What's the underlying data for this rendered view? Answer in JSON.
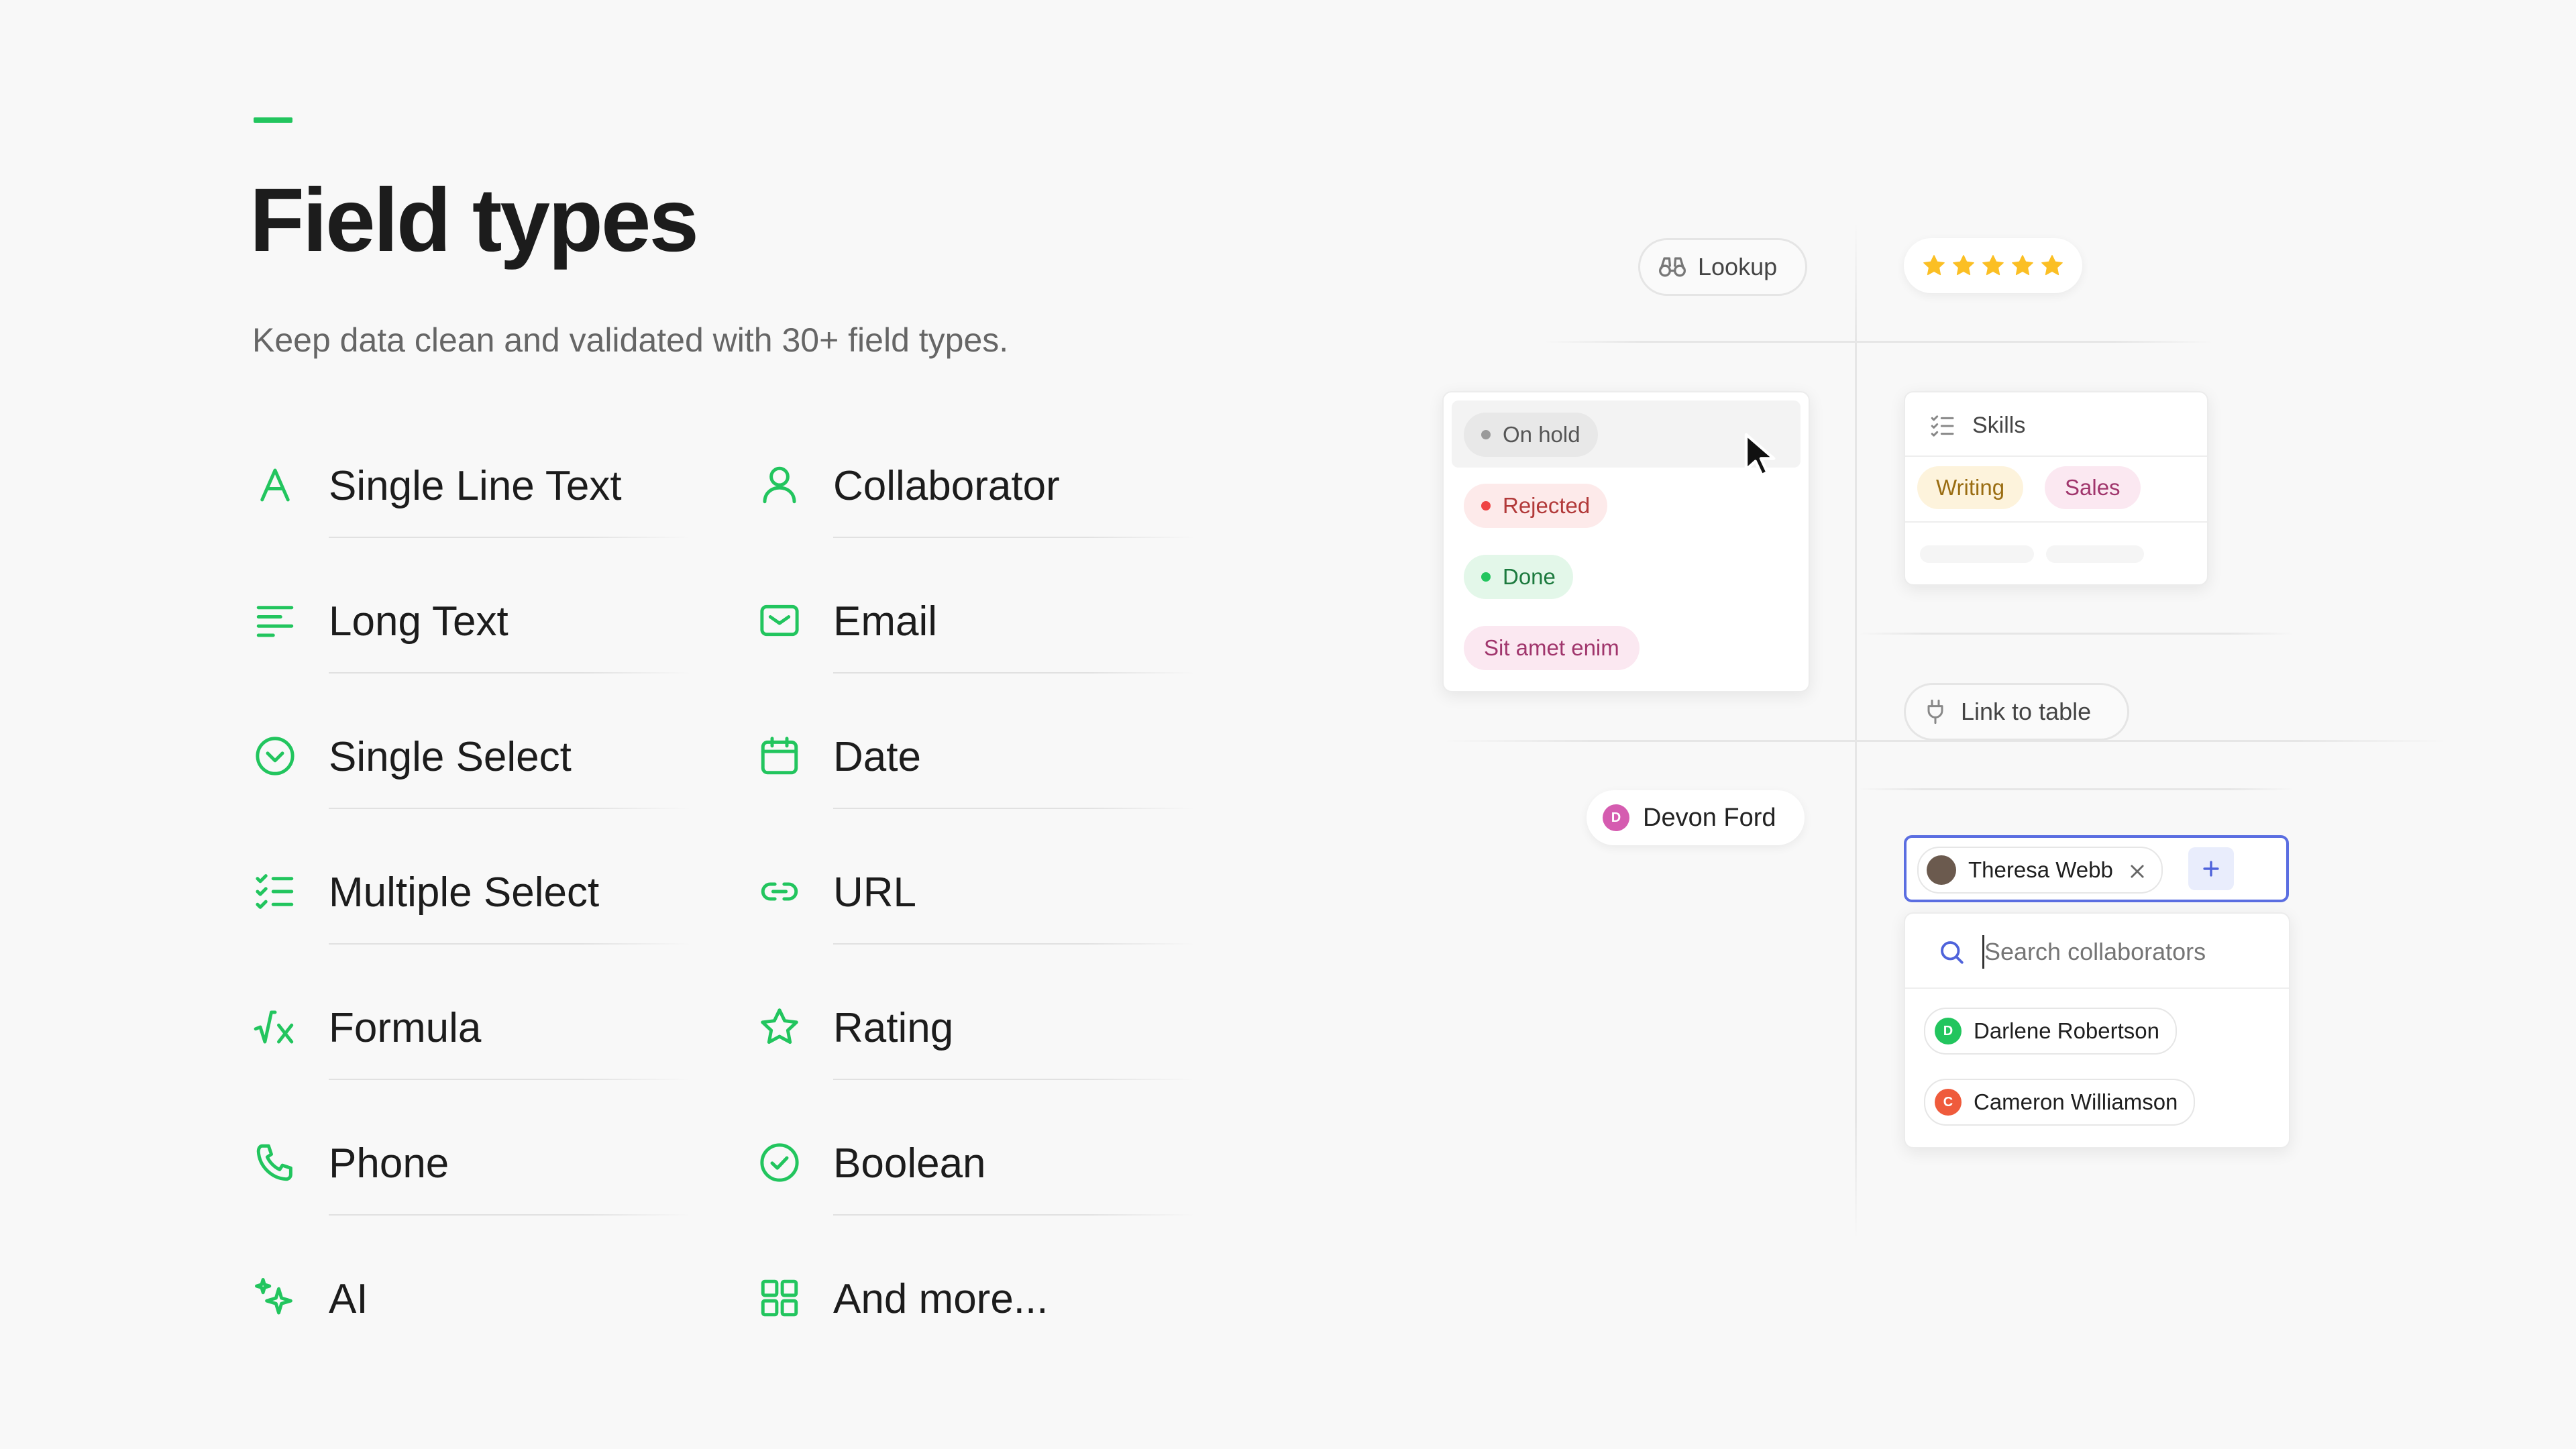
{
  "header": {
    "title": "Field types",
    "subtitle": "Keep data clean and validated with 30+ field types."
  },
  "field_types": {
    "left": [
      "Single Line Text",
      "Long Text",
      "Single Select",
      "Multiple Select",
      "Formula",
      "Phone",
      "AI"
    ],
    "right": [
      "Collaborator",
      "Email",
      "Date",
      "URL",
      "Rating",
      "Boolean",
      "And more..."
    ]
  },
  "illustration": {
    "lookup_label": "Lookup",
    "rating_value": 5,
    "status_options": [
      "On hold",
      "Rejected",
      "Done",
      "Sit amet enim"
    ],
    "skills": {
      "title": "Skills",
      "tags": [
        "Writing",
        "Sales"
      ]
    },
    "link_to_table_label": "Link to table",
    "devon": {
      "initial": "D",
      "name": "Devon Ford"
    },
    "collaborator_picker": {
      "selected_name": "Theresa Webb",
      "search_placeholder": "Search collaborators",
      "options": [
        {
          "initial": "D",
          "name": "Darlene Robertson"
        },
        {
          "initial": "C",
          "name": "Cameron Williamson"
        }
      ]
    }
  },
  "colors": {
    "accent": "#22c55e",
    "star": "#fbbf24",
    "focus_border": "#5b6ee1"
  }
}
